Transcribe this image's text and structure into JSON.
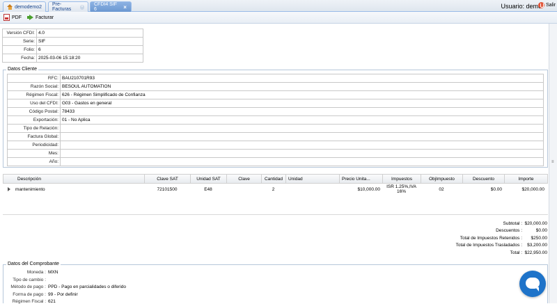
{
  "tabs": [
    {
      "label": "demodemo2",
      "active": false
    },
    {
      "label": "Pre-Facturas",
      "active": false
    },
    {
      "label": "CFDI4 SIF 6",
      "active": true
    }
  ],
  "user": {
    "label": "Usuario: demo",
    "exit_label": "Salir"
  },
  "toolbar": {
    "pdf_label": "PDF",
    "facturar_label": "Facturar"
  },
  "header_fields": [
    {
      "key": "Versión CFDI:",
      "value": "4.0"
    },
    {
      "key": "Serie:",
      "value": "SIF"
    },
    {
      "key": "Folio:",
      "value": "6"
    },
    {
      "key": "Fecha:",
      "value": "2025-03-06 15:18:20"
    }
  ],
  "cliente": {
    "legend": "Datos Cliente",
    "fields": [
      {
        "key": "RFC:",
        "value": "BAU210701R93"
      },
      {
        "key": "Razón Social:",
        "value": "BESOUL AUTOMATION"
      },
      {
        "key": "Régimen Fiscal:",
        "value": "626 - Régimen Simplificado de Confianza"
      },
      {
        "key": "Uso del CFDI:",
        "value": "G03 - Gastos en general"
      },
      {
        "key": "Código Postal:",
        "value": "78433"
      },
      {
        "key": "Exportación:",
        "value": "01 - No Aplica"
      },
      {
        "key": "Tipo de Relación:",
        "value": ""
      },
      {
        "key": "Factura Global:",
        "value": ""
      },
      {
        "key": "Periodicidad:",
        "value": ""
      },
      {
        "key": "Mes:",
        "value": ""
      },
      {
        "key": "Año:",
        "value": ""
      }
    ]
  },
  "grid": {
    "columns": [
      "Descripción",
      "Clave SAT",
      "Unidad SAT",
      "Clave",
      "Cantidad",
      "Unidad",
      "Precio Unita...",
      "Impuestos",
      "ObjImpuesto",
      "Descuento",
      "Importe"
    ],
    "rows": [
      {
        "descripcion": "mantenimiento",
        "clave_sat": "72101500",
        "unidad_sat": "E48",
        "clave": "",
        "cantidad": "2",
        "unidad": "",
        "precio": "$10,000.00",
        "impuestos": "ISR 1.25%,IVA 16%",
        "obj_impuesto": "02",
        "descuento": "$0.00",
        "importe": "$20,000.00"
      }
    ]
  },
  "totals": [
    {
      "label": "Subtotal :",
      "value": "$20,000.00"
    },
    {
      "label": "Descuentos :",
      "value": "$0.00"
    },
    {
      "label": "Total de Impuestos Retenidos :",
      "value": "$250.00"
    },
    {
      "label": "Total de Impuestos Trasladados :",
      "value": "$3,200.00"
    },
    {
      "label": "Total :",
      "value": "$22,950.00"
    }
  ],
  "comprobante": {
    "legend": "Datos del Comprobante",
    "fields": [
      {
        "key": "Moneda :",
        "value": "MXN"
      },
      {
        "key": "Tipo de cambio :",
        "value": ""
      },
      {
        "key": "Método de pago :",
        "value": "PPD - Pago en parcialidades o diferido"
      },
      {
        "key": "Forma de pago :",
        "value": "99 - Por definir"
      },
      {
        "key": "Régimen Fiscal :",
        "value": "621"
      }
    ]
  },
  "colors": {
    "accent": "#1e73c9",
    "tab_active": "#7aa3d9",
    "border": "#b5c6da"
  },
  "icons": [
    "home-icon",
    "close-icon",
    "exit-icon",
    "pdf-icon",
    "facturar-icon",
    "expand-icon",
    "chat-icon"
  ]
}
